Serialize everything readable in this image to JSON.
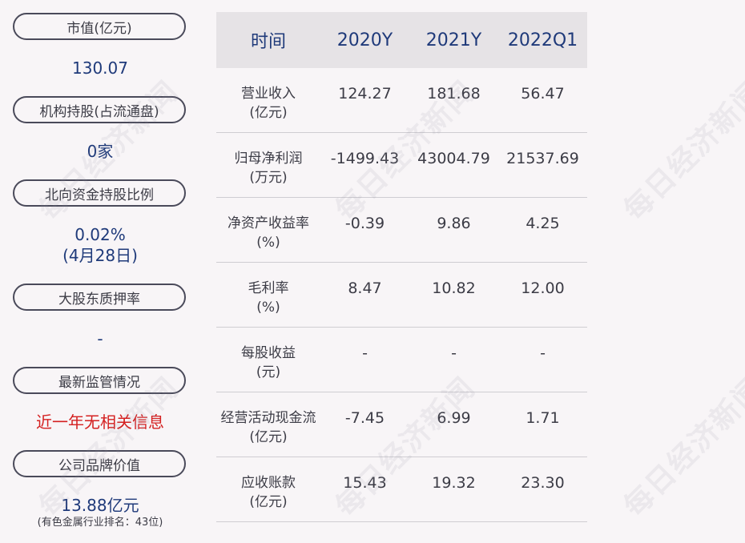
{
  "left_panel": {
    "items": [
      {
        "label": "市值(亿元)",
        "value": "130.07"
      },
      {
        "label": "机构持股(占流通盘)",
        "value": "0家"
      },
      {
        "label": "北向资金持股比例",
        "value": "0.02%",
        "value2": "(4月28日)"
      },
      {
        "label": "大股东质押率",
        "value": "-"
      },
      {
        "label": "最新监管情况",
        "value": "近一年无相关信息"
      },
      {
        "label": "公司品牌价值",
        "value": "13.88亿元",
        "note": "(有色金属行业排名：43位)"
      }
    ]
  },
  "table": {
    "headers": [
      "时间",
      "2020Y",
      "2021Y",
      "2022Q1"
    ],
    "rows": [
      {
        "label": "营业收入",
        "unit": "(亿元)",
        "values": [
          "124.27",
          "181.68",
          "56.47"
        ]
      },
      {
        "label": "归母净利润",
        "unit": "(万元)",
        "values": [
          "-1499.43",
          "43004.79",
          "21537.69"
        ]
      },
      {
        "label": "净资产收益率",
        "unit": "(%)",
        "values": [
          "-0.39",
          "9.86",
          "4.25"
        ]
      },
      {
        "label": "毛利率",
        "unit": "(%)",
        "values": [
          "8.47",
          "10.82",
          "12.00"
        ]
      },
      {
        "label": "每股收益",
        "unit": "(元)",
        "values": [
          "-",
          "-",
          "-"
        ]
      },
      {
        "label": "经营活动现金流",
        "unit": "(亿元)",
        "values": [
          "-7.45",
          "6.99",
          "1.71"
        ]
      },
      {
        "label": "应收账款",
        "unit": "(亿元)",
        "values": [
          "15.43",
          "19.32",
          "23.30"
        ]
      }
    ]
  },
  "watermark": "每日经济新闻"
}
